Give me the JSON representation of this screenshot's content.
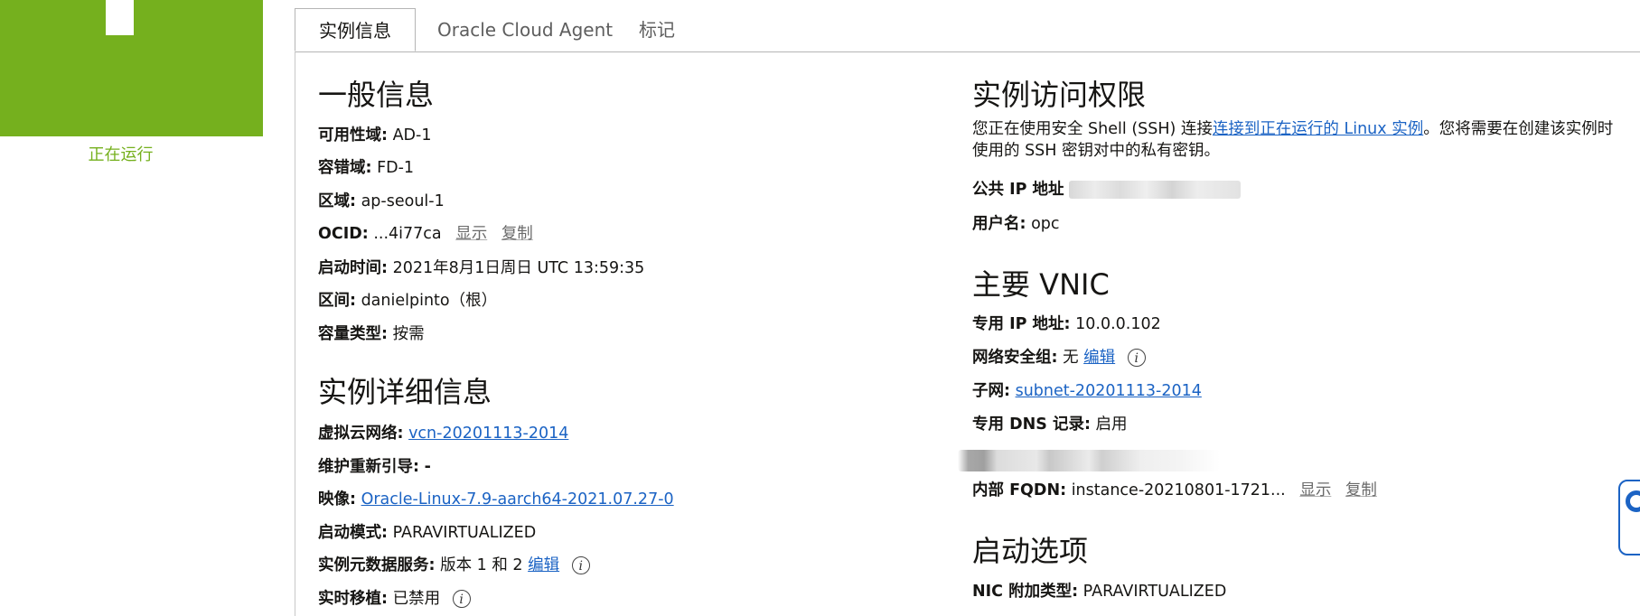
{
  "status": {
    "label": "正在运行",
    "color": "#75b01e"
  },
  "tabs": [
    {
      "label": "实例信息",
      "active": true
    },
    {
      "label": "Oracle Cloud Agent",
      "active": false
    },
    {
      "label": "标记",
      "active": false
    }
  ],
  "general": {
    "heading": "一般信息",
    "ad": {
      "key": "可用性域:",
      "value": "AD-1"
    },
    "fd": {
      "key": "容错域:",
      "value": "FD-1"
    },
    "region": {
      "key": "区域:",
      "value": "ap-seoul-1"
    },
    "ocid": {
      "key": "OCID:",
      "value": "...4i77ca",
      "show": "显示",
      "copy": "复制"
    },
    "launched": {
      "key": "启动时间:",
      "value": "2021年8月1日周日 UTC 13:59:35"
    },
    "compartment": {
      "key": "区间:",
      "value": "danielpinto（根）"
    },
    "capacity": {
      "key": "容量类型:",
      "value": "按需"
    }
  },
  "details": {
    "heading": "实例详细信息",
    "vcn": {
      "key": "虚拟云网络:",
      "value": "vcn-20201113-2014"
    },
    "maintenance": {
      "key": "维护重新引导:",
      "value": "-"
    },
    "image": {
      "key": "映像:",
      "value": "Oracle-Linux-7.9-aarch64-2021.07.27-0"
    },
    "launch_mode": {
      "key": "启动模式:",
      "value": "PARAVIRTUALIZED"
    },
    "metadata": {
      "key": "实例元数据服务:",
      "value": "版本 1 和 2",
      "edit": "编辑"
    },
    "live_migration": {
      "key": "实时移植:",
      "value": "已禁用"
    }
  },
  "access": {
    "heading": "实例访问权限",
    "text_before": "您正在使用安全 Shell (SSH) 连接",
    "link": "连接到正在运行的 Linux 实例",
    "text_after": "。您将需要在创建该实例时使用的 SSH 密钥对中的私有密钥。",
    "public_ip_key": "公共 IP 地址",
    "username": {
      "key": "用户名:",
      "value": "opc"
    }
  },
  "vnic": {
    "heading": "主要 VNIC",
    "private_ip": {
      "key": "专用 IP 地址:",
      "value": "10.0.0.102"
    },
    "nsg": {
      "key": "网络安全组:",
      "value": "无",
      "edit": "编辑"
    },
    "subnet": {
      "key": "子网:",
      "value": "subnet-20201113-2014"
    },
    "dns": {
      "key": "专用 DNS 记录:",
      "value": "启用"
    },
    "fqdn": {
      "key": "内部 FQDN:",
      "value": "instance-20210801-1721...",
      "show": "显示",
      "copy": "复制"
    }
  },
  "launch_options": {
    "heading": "启动选项",
    "nic": {
      "key": "NIC 附加类型:",
      "value": "PARAVIRTUALIZED"
    }
  },
  "icons": [
    "info-icon",
    "lifebuoy-icon"
  ],
  "colors": {
    "accent": "#75b01e",
    "link": "#1b63c4"
  }
}
